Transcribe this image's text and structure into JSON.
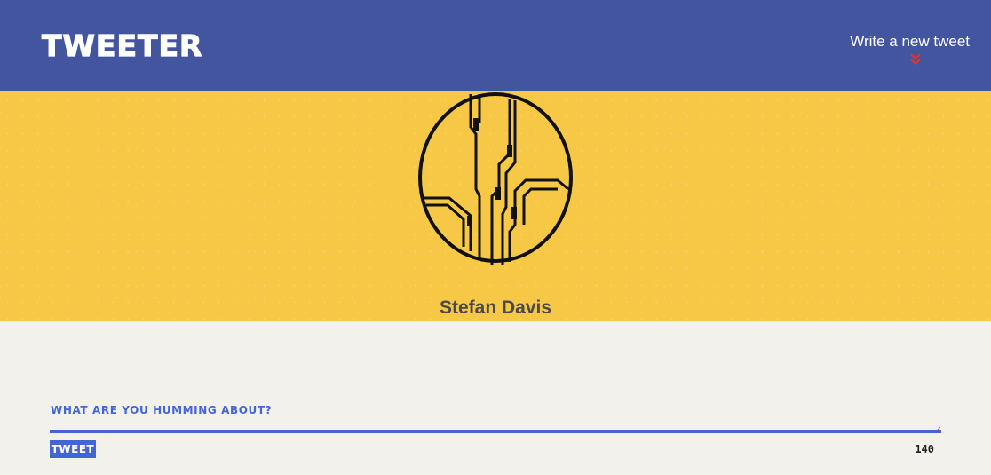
{
  "nav": {
    "logo": "TWEETER",
    "write_link": "Write a new tweet",
    "chevron_icon": "double-chevron-down-icon",
    "chevron_color": "#e2332c"
  },
  "profile": {
    "avatar_icon": "circuit-avatar-icon",
    "name": "Stefan Davis"
  },
  "compose": {
    "label": "What are you humming about?",
    "value": "",
    "placeholder": "",
    "button_label": "Tweet",
    "char_counter": "140"
  },
  "colors": {
    "nav_bg": "#4455a0",
    "hero_bg": "#f7c846",
    "page_bg": "#f3f1ec",
    "accent": "#4466d4"
  }
}
